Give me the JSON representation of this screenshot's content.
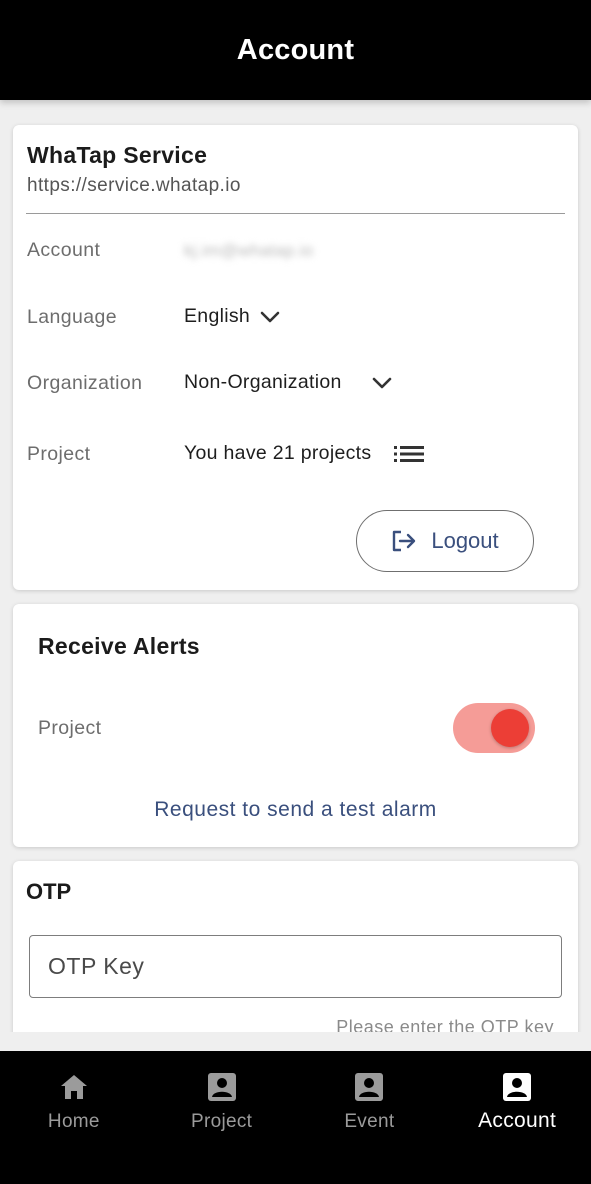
{
  "header": {
    "title": "Account"
  },
  "service": {
    "name": "WhaTap Service",
    "url": "https://service.whatap.io",
    "rows": {
      "account": {
        "label": "Account",
        "value": "kj.im@whatap.io"
      },
      "language": {
        "label": "Language",
        "value": "English"
      },
      "organization": {
        "label": "Organization",
        "value": "Non-Organization"
      },
      "project": {
        "label": "Project",
        "value": "You have 21 projects"
      }
    },
    "logout_label": "Logout"
  },
  "alerts": {
    "title": "Receive Alerts",
    "project_label": "Project",
    "project_enabled": true,
    "test_alarm_label": "Request to send a test alarm"
  },
  "otp": {
    "title": "OTP",
    "input_placeholder": "OTP Key",
    "input_value": "",
    "helper": "Please enter the OTP key"
  },
  "nav": {
    "items": [
      {
        "label": "Home",
        "icon": "home-icon",
        "active": false
      },
      {
        "label": "Project",
        "icon": "project-icon",
        "active": false
      },
      {
        "label": "Event",
        "icon": "event-icon",
        "active": false
      },
      {
        "label": "Account",
        "icon": "account-icon",
        "active": true
      }
    ]
  },
  "colors": {
    "accent_link": "#3a4f7d",
    "toggle_track": "#f59c97",
    "toggle_knob": "#ec3e36",
    "header_bg": "#000000"
  }
}
